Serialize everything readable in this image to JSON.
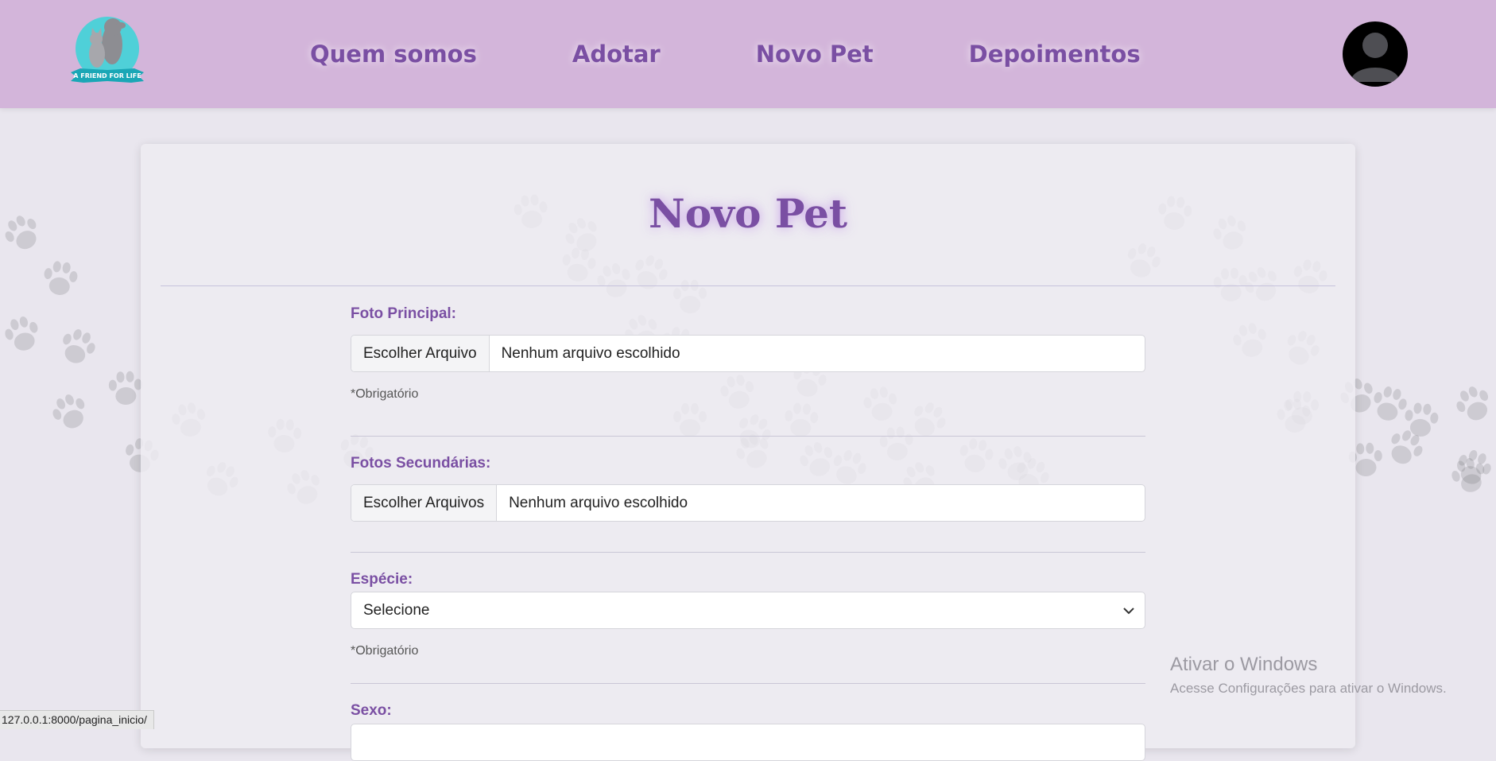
{
  "header": {
    "logo": {
      "icon": "pet-logo-icon",
      "text": "A FRIEND FOR LIFE"
    },
    "nav": [
      "Quem somos",
      "Adotar",
      "Novo Pet",
      "Depoimentos"
    ],
    "avatar_icon": "user-avatar-icon"
  },
  "page": {
    "title": "Novo Pet"
  },
  "form": {
    "main_photo": {
      "label": "Foto Principal:",
      "button": "Escolher Arquivo",
      "value": "Nenhum arquivo escolhido",
      "hint": "*Obrigatório"
    },
    "secondary_photos": {
      "label": "Fotos Secundárias:",
      "button": "Escolher Arquivos",
      "value": "Nenhum arquivo escolhido"
    },
    "species": {
      "label": "Espécie:",
      "value": "Selecione",
      "hint": "*Obrigatório"
    },
    "sex": {
      "label": "Sexo:"
    }
  },
  "watermark": {
    "title": "Ativar o Windows",
    "subtitle": "Acesse Configurações para ativar o Windows."
  },
  "status_bar": {
    "url": "127.0.0.1:8000/pagina_inicio/"
  },
  "colors": {
    "header": "#d3b5da",
    "accent": "#7a4fa3",
    "background": "#e9e6ee"
  }
}
